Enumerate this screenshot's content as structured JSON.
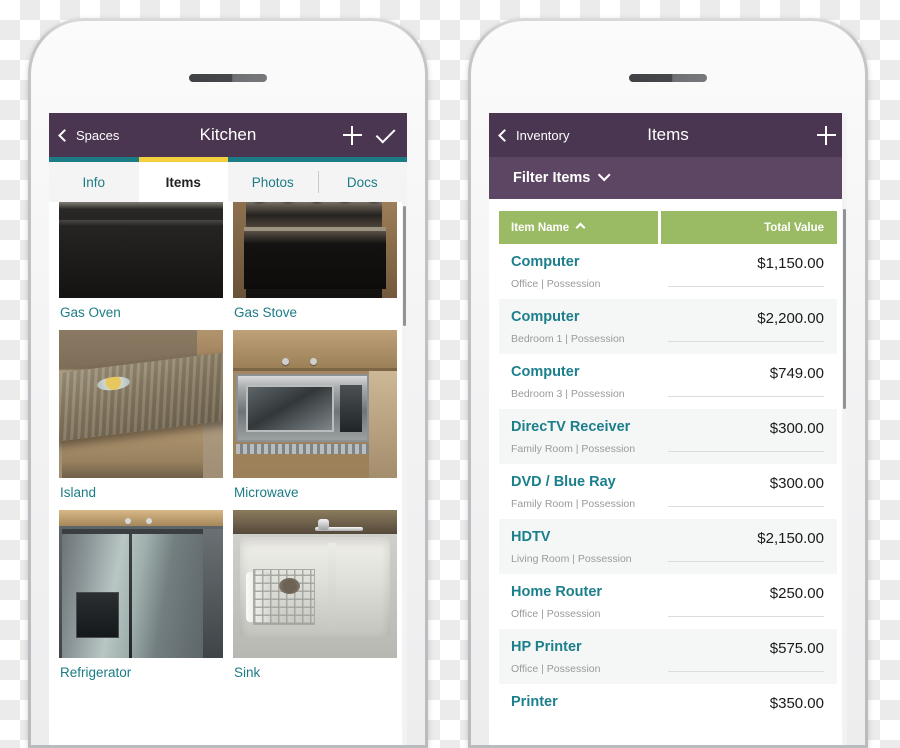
{
  "left_phone": {
    "navbar": {
      "back_label": "Spaces",
      "title": "Kitchen",
      "add_icon": "plus-icon",
      "confirm_icon": "check-icon"
    },
    "tabs": [
      {
        "label": "Info",
        "active": false
      },
      {
        "label": "Items",
        "active": true
      },
      {
        "label": "Photos",
        "active": false
      },
      {
        "label": "Docs",
        "active": false
      }
    ],
    "items": [
      {
        "label": "Gas Oven",
        "photo": "gas-oven"
      },
      {
        "label": "Gas Stove",
        "photo": "gas-stove"
      },
      {
        "label": "Island",
        "photo": "island"
      },
      {
        "label": "Microwave",
        "photo": "microwave"
      },
      {
        "label": "Refrigerator",
        "photo": "refrigerator"
      },
      {
        "label": "Sink",
        "photo": "sink"
      }
    ]
  },
  "right_phone": {
    "navbar": {
      "back_label": "Inventory",
      "title": "Items",
      "add_icon": "plus-icon"
    },
    "filter": {
      "label": "Filter Items",
      "chevron_icon": "chevron-down-icon"
    },
    "table": {
      "columns": [
        {
          "label": "Item Name",
          "sort": "ascending",
          "sort_icon": "caret-up-icon"
        },
        {
          "label": "Total Value",
          "sort": "none"
        }
      ],
      "rows": [
        {
          "name": "Computer",
          "location": "Office | Possession",
          "value": "$1,150.00"
        },
        {
          "name": "Computer",
          "location": "Bedroom 1 | Possession",
          "value": "$2,200.00"
        },
        {
          "name": "Computer",
          "location": "Bedroom 3 | Possession",
          "value": "$749.00"
        },
        {
          "name": "DirecTV Receiver",
          "location": "Family Room | Possession",
          "value": "$300.00"
        },
        {
          "name": "DVD / Blue Ray",
          "location": "Family Room | Possession",
          "value": "$300.00"
        },
        {
          "name": "HDTV",
          "location": "Living Room | Possession",
          "value": "$2,150.00"
        },
        {
          "name": "Home Router",
          "location": "Office | Possession",
          "value": "$250.00"
        },
        {
          "name": "HP Printer",
          "location": "Office | Possession",
          "value": "$575.00"
        },
        {
          "name": "Printer",
          "location": "",
          "value": "$350.00"
        }
      ]
    }
  },
  "colors": {
    "navbar_purple": "#4a3651",
    "filter_purple": "#5d4663",
    "table_green": "#9aba63",
    "teal_link": "#1b7f8c",
    "tab_strip_teal": "#1c7c85",
    "active_tab_yellow": "#f4d03f"
  }
}
